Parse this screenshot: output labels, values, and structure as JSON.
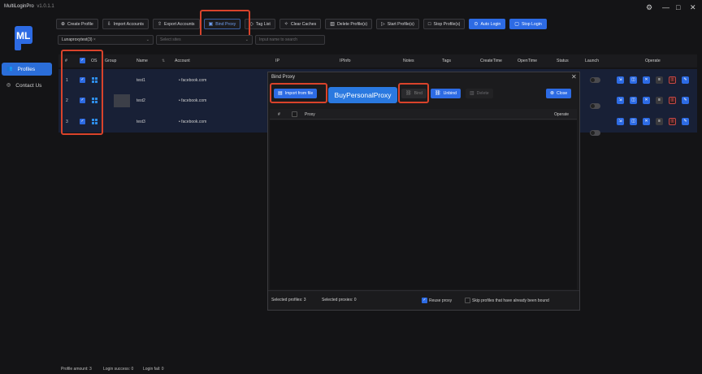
{
  "app": {
    "title": "MultiLoginPro",
    "version": "v1.0.1.1"
  },
  "window": {
    "settings_icon": "gear-icon",
    "minimize": "—",
    "maximize": "□",
    "close": "✕"
  },
  "sidebar": {
    "items": [
      {
        "label": "Profiles",
        "active": true
      },
      {
        "label": "Contact Us",
        "active": false
      }
    ]
  },
  "toolbar": {
    "create": "Create Profile",
    "import": "Import Accounts",
    "export": "Export Accounts",
    "bind_proxy": "Bind Proxy",
    "tag_list": "Tag List",
    "clear_caches": "Clear Caches",
    "delete": "Delete Profile(s)",
    "start": "Start Profile(s)",
    "stop": "Stop Profile(s)",
    "auto_login": "Auto Login",
    "stop_login": "Stop Login"
  },
  "filters": {
    "group_value": "Lunaproxytest(3)",
    "site_placeholder": "Select sites",
    "name_placeholder": "Input name to search"
  },
  "table": {
    "headers": {
      "num": "#",
      "os": "OS",
      "group": "Group",
      "name": "Name",
      "account": "Account",
      "ip": "IP",
      "ipinfo": "IPInfo",
      "notes": "Notes",
      "tags": "Tags",
      "createtime": "CreateTime",
      "opentime": "OpenTime",
      "status": "Status",
      "launch": "Launch",
      "operate": "Operate"
    },
    "rows": [
      {
        "num": "1",
        "name": "test1",
        "account": "facebook.com"
      },
      {
        "num": "2",
        "name": "test2",
        "account": "facebook.com"
      },
      {
        "num": "3",
        "name": "test3",
        "account": "facebook.com"
      }
    ]
  },
  "dialog": {
    "title": "Bind Proxy",
    "import_from_file": "Import from file",
    "buy_personal_proxy": "BuyPersonalProxy",
    "bind": "Bind",
    "unbind": "Unbind",
    "delete": "Delete",
    "close": "Close",
    "col_num": "#",
    "col_proxy": "Proxy",
    "col_operate": "Operate",
    "selected_profiles": "Selected profiles: 3",
    "selected_proxies": "Selected proxies: 0",
    "reuse_proxy": "Reuse proxy",
    "skip_bound": "Skip profiles that have already been bound"
  },
  "status": {
    "profile_amount": "Profile amount: 3",
    "login_success": "Login success: 0",
    "login_fail": "Login fail: 0"
  },
  "colors": {
    "accent": "#2d6be4",
    "highlight_box": "#d9432b",
    "row_selected": "#182036"
  }
}
